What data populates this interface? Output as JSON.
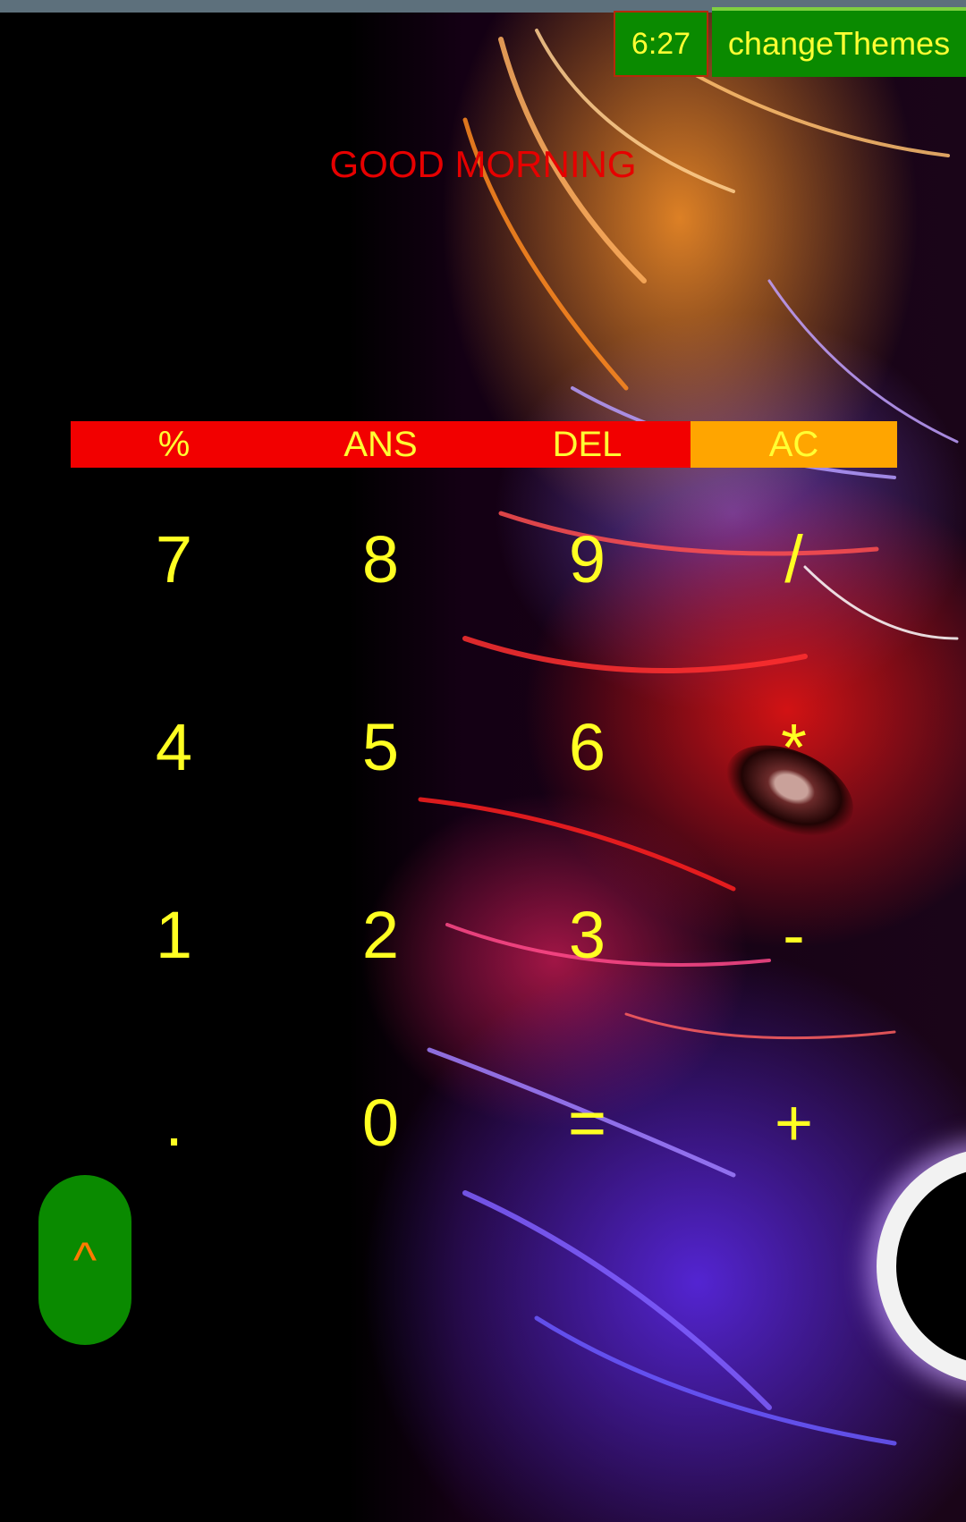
{
  "header": {
    "time": "6:27",
    "theme_button": "changeThemes"
  },
  "greeting": "GOOD MORNING",
  "function_keys": [
    "%",
    "ANS",
    "DEL",
    "AC"
  ],
  "keys": {
    "r1": [
      "7",
      "8",
      "9",
      "/"
    ],
    "r2": [
      "4",
      "5",
      "6",
      "*"
    ],
    "r3": [
      "1",
      "2",
      "3",
      "-"
    ],
    "r4": [
      ".",
      "0",
      "=",
      "+"
    ]
  },
  "fab": {
    "label": "^"
  },
  "colors": {
    "key_text": "#ffff22",
    "greeting_text": "#e60000",
    "fn_bar": "#f20000",
    "ac_key": "#ffa500",
    "button_green": "#0a8a00",
    "fab_glyph": "#ff7a00"
  }
}
